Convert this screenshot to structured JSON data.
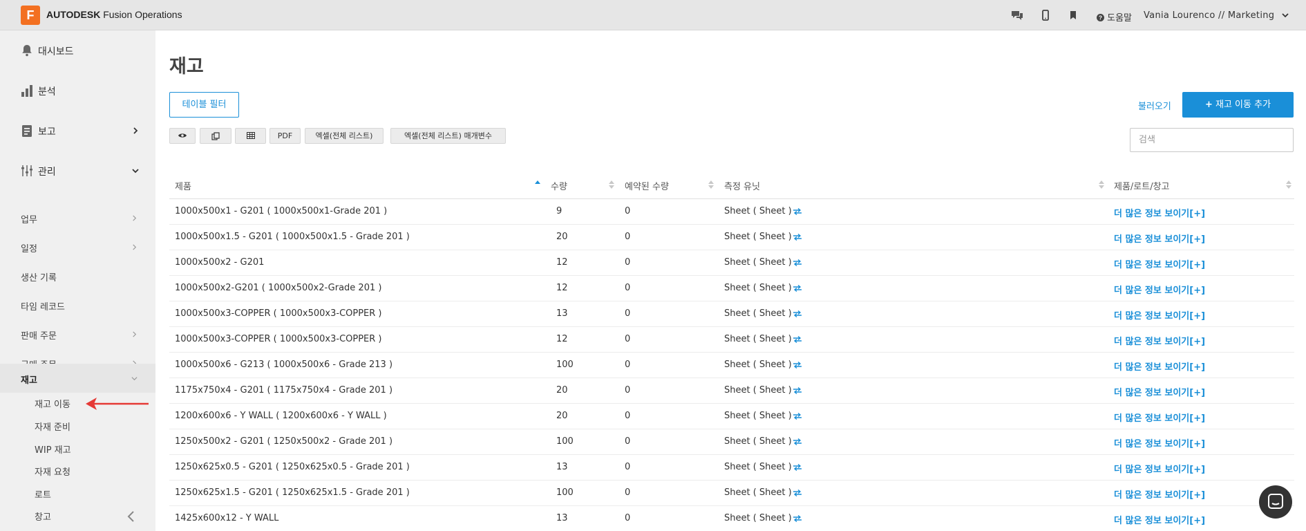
{
  "header": {
    "logo_letter": "F",
    "brand_bold": "AUTODESK",
    "brand_rest": "Fusion Operations",
    "help_label": "도움말",
    "user_label": "Vania Lourenco // Marketing",
    "icons": [
      "chat-icon",
      "mobile-icon",
      "bookmark-icon",
      "help-icon",
      "chevron-down-icon"
    ]
  },
  "sidebar": {
    "top_items": [
      {
        "label": "대시보드",
        "icon": "bell-icon"
      },
      {
        "label": "분석",
        "icon": "bar-chart-icon"
      },
      {
        "label": "보고",
        "icon": "document-icon"
      },
      {
        "label": "관리",
        "icon": "sliders-icon"
      }
    ],
    "sub_items": [
      {
        "label": "업무"
      },
      {
        "label": "일정"
      },
      {
        "label": "생산 기록"
      },
      {
        "label": "타임 레코드"
      },
      {
        "label": "판매 주문"
      },
      {
        "label": "구매 주문"
      },
      {
        "label": "재고"
      }
    ],
    "inventory_items": [
      {
        "label": "재고 이동"
      },
      {
        "label": "자재 준비"
      },
      {
        "label": "WIP 재고"
      },
      {
        "label": "자재 요청"
      },
      {
        "label": "로트"
      },
      {
        "label": "창고"
      }
    ]
  },
  "main": {
    "title": "재고",
    "filter_button": "테이블 필터",
    "load_link": "불러오기",
    "add_button": "재고 이동 추가",
    "toolbar": {
      "pdf": "PDF",
      "excel_all": "엑셀(전체 리스트)",
      "excel_params": "엑셀(전체 리스트) 매개변수"
    },
    "search_placeholder": "검색"
  },
  "table": {
    "columns": {
      "product": "제품",
      "qty": "수량",
      "reserved": "예약된 수량",
      "uom": "측정 유닛",
      "plw": "제품/로트/창고"
    },
    "sort_color": "#1a8fd8",
    "rows": [
      {
        "product": "1000x500x1 - G201 ( 1000x500x1-Grade 201 )",
        "qty": "9",
        "reserved": "0",
        "uom": "Sheet ( Sheet )",
        "more": "더 많은 정보 보이기[+]"
      },
      {
        "product": "1000x500x1.5 - G201 ( 1000x500x1.5 - Grade 201 )",
        "qty": "20",
        "reserved": "0",
        "uom": "Sheet ( Sheet )",
        "more": "더 많은 정보 보이기[+]"
      },
      {
        "product": "1000x500x2 - G201",
        "qty": "12",
        "reserved": "0",
        "uom": "Sheet ( Sheet )",
        "more": "더 많은 정보 보이기[+]"
      },
      {
        "product": "1000x500x2-G201 ( 1000x500x2-Grade 201 )",
        "qty": "12",
        "reserved": "0",
        "uom": "Sheet ( Sheet )",
        "more": "더 많은 정보 보이기[+]"
      },
      {
        "product": "1000x500x3-COPPER ( 1000x500x3-COPPER )",
        "qty": "13",
        "reserved": "0",
        "uom": "Sheet ( Sheet )",
        "more": "더 많은 정보 보이기[+]"
      },
      {
        "product": "1000x500x3-COPPER ( 1000x500x3-COPPER )",
        "qty": "12",
        "reserved": "0",
        "uom": "Sheet ( Sheet )",
        "more": "더 많은 정보 보이기[+]"
      },
      {
        "product": "1000x500x6 - G213 ( 1000x500x6 - Grade 213 )",
        "qty": "100",
        "reserved": "0",
        "uom": "Sheet ( Sheet )",
        "more": "더 많은 정보 보이기[+]"
      },
      {
        "product": "1175x750x4 - G201 ( 1175x750x4 - Grade 201 )",
        "qty": "20",
        "reserved": "0",
        "uom": "Sheet ( Sheet )",
        "more": "더 많은 정보 보이기[+]"
      },
      {
        "product": "1200x600x6 - Y WALL ( 1200x600x6 - Y WALL )",
        "qty": "20",
        "reserved": "0",
        "uom": "Sheet ( Sheet )",
        "more": "더 많은 정보 보이기[+]"
      },
      {
        "product": "1250x500x2 - G201 ( 1250x500x2 - Grade 201 )",
        "qty": "100",
        "reserved": "0",
        "uom": "Sheet ( Sheet )",
        "more": "더 많은 정보 보이기[+]"
      },
      {
        "product": "1250x625x0.5 - G201 ( 1250x625x0.5 - Grade 201 )",
        "qty": "13",
        "reserved": "0",
        "uom": "Sheet ( Sheet )",
        "more": "더 많은 정보 보이기[+]"
      },
      {
        "product": "1250x625x1.5 - G201 ( 1250x625x1.5 - Grade 201 )",
        "qty": "100",
        "reserved": "0",
        "uom": "Sheet ( Sheet )",
        "more": "더 많은 정보 보이기[+]"
      },
      {
        "product": "1425x600x12 - Y WALL",
        "qty": "13",
        "reserved": "0",
        "uom": "Sheet ( Sheet )",
        "more": "더 많은 정보 보이기[+]"
      }
    ]
  },
  "colors": {
    "accent": "#1a8fd8",
    "brand": "#f37021",
    "annotation": "#e53935"
  }
}
